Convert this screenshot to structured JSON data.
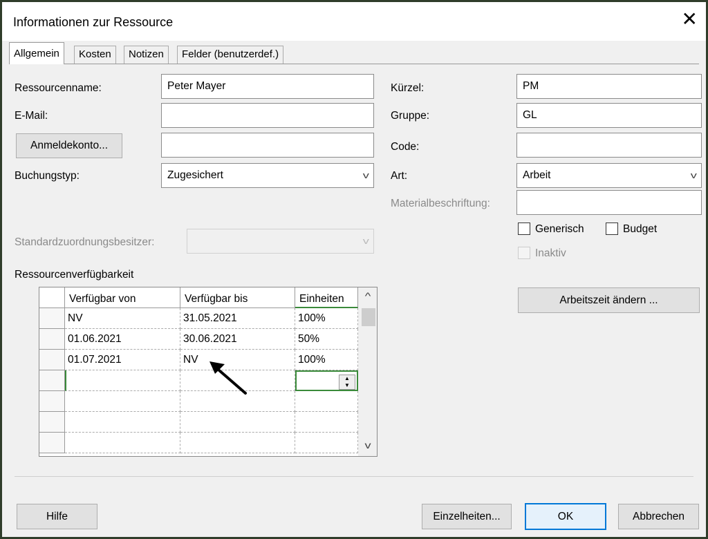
{
  "title": "Informationen zur Ressource",
  "close_glyph": "✕",
  "tabs": [
    {
      "label": "Allgemein"
    },
    {
      "label": "Kosten"
    },
    {
      "label": "Notizen"
    },
    {
      "label": "Felder (benutzerdef.)"
    }
  ],
  "left": {
    "name_label": "Ressourcenname:",
    "name_value": "Peter Mayer",
    "email_label": "E-Mail:",
    "email_value": "",
    "login_button": "Anmeldekonto...",
    "login_value": "",
    "booking_label": "Buchungstyp:",
    "booking_value": "Zugesichert",
    "owner_label": "Standardzuordnungsbesitzer:",
    "owner_value": ""
  },
  "right": {
    "initials_label": "Kürzel:",
    "initials_value": "PM",
    "group_label": "Gruppe:",
    "group_value": "GL",
    "code_label": "Code:",
    "code_value": "",
    "type_label": "Art:",
    "type_value": "Arbeit",
    "material_label": "Materialbeschriftung:",
    "material_value": "",
    "generic_label": "Generisch",
    "budget_label": "Budget",
    "inactive_label": "Inaktiv",
    "worktime_button": "Arbeitszeit ändern ..."
  },
  "availability": {
    "label": "Ressourcenverfügbarkeit",
    "headers": [
      "Verfügbar von",
      "Verfügbar bis",
      "Einheiten"
    ],
    "rows": [
      {
        "from": "NV",
        "to": "31.05.2021",
        "units": "100%"
      },
      {
        "from": "01.06.2021",
        "to": "30.06.2021",
        "units": "50%"
      },
      {
        "from": "01.07.2021",
        "to": "NV",
        "units": "100%"
      }
    ]
  },
  "footer": {
    "help": "Hilfe",
    "details": "Einzelheiten...",
    "ok": "OK",
    "cancel": "Abbrechen"
  }
}
